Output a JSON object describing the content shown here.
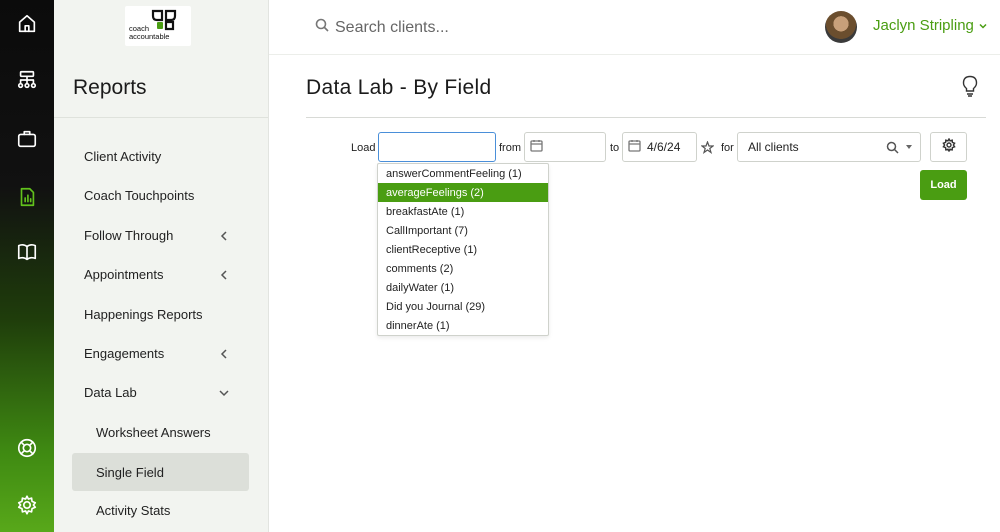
{
  "app": {
    "logo_text": [
      "coach",
      "accountable"
    ]
  },
  "header": {
    "search_placeholder": "Search clients...",
    "user_name": "Jaclyn Stripling"
  },
  "sidebar": {
    "title": "Reports",
    "items": [
      {
        "label": "Client Activity"
      },
      {
        "label": "Coach Touchpoints"
      },
      {
        "label": "Follow Through"
      },
      {
        "label": "Appointments"
      },
      {
        "label": "Happenings Reports"
      },
      {
        "label": "Engagements"
      },
      {
        "label": "Data Lab"
      },
      {
        "label": "Worksheet Answers"
      },
      {
        "label": "Single Field"
      },
      {
        "label": "Activity Stats"
      }
    ]
  },
  "main": {
    "title": "Data Lab - By Field",
    "filters": {
      "load_label": "Load",
      "field_value": "",
      "from_label": "from",
      "from_value": "",
      "to_label": "to",
      "to_value": "4/6/24",
      "for_label": "for",
      "client_value": "All clients",
      "load_button": "Load"
    },
    "field_options": [
      "answerCommentFeeling (1)",
      "averageFeelings (2)",
      "breakfastAte (1)",
      "CallImportant (7)",
      "clientReceptive (1)",
      "comments (2)",
      "dailyWater (1)",
      "Did you Journal (29)",
      "dinnerAte (1)"
    ],
    "highlighted_option": "averageFeelings (2)"
  },
  "colors": {
    "accent": "#4a9d12",
    "focus_border": "#4a8fd9"
  }
}
